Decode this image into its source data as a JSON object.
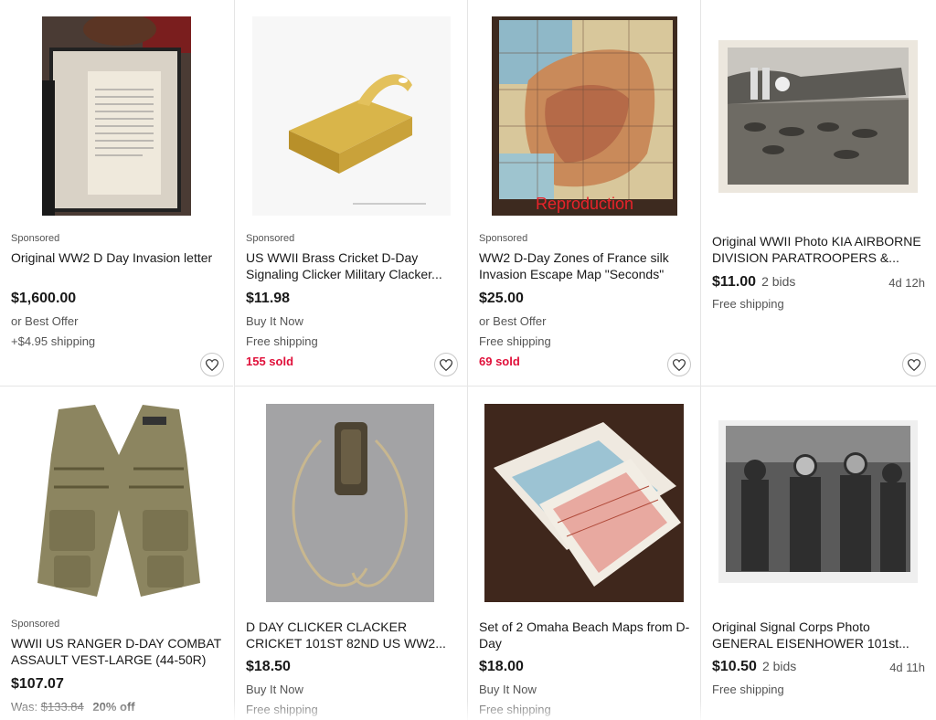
{
  "colors": {
    "sold_red": "#e0103a",
    "text": "#191919",
    "muted": "#555555"
  },
  "listings": [
    {
      "sponsored": "Sponsored",
      "title": "Original WW2 D Day Invasion letter",
      "price": "$1,600.00",
      "line1": "or Best Offer",
      "line2": "+$4.95 shipping",
      "image": "framed-letter-image",
      "watch_icon": "heart-icon"
    },
    {
      "sponsored": "Sponsored",
      "title": "US WWII Brass Cricket D-Day Signaling Clicker Military Clacker...",
      "price": "$11.98",
      "line1": "Buy It Now",
      "line2": "Free shipping",
      "sold": "155 sold",
      "image": "brass-cricket-image",
      "watch_icon": "heart-icon"
    },
    {
      "sponsored": "Sponsored",
      "title": "WW2 D-Day Zones of France silk Invasion Escape Map \"Seconds\"",
      "price": "$25.00",
      "line1": "or Best Offer",
      "line2": "Free shipping",
      "sold": "69 sold",
      "image_overlay": "Reproduction",
      "image": "france-map-image",
      "watch_icon": "heart-icon"
    },
    {
      "title": "Original WWII Photo KIA AIRBORNE DIVISION PARATROOPERS &...",
      "price": "$11.00",
      "bids": "2 bids",
      "time_left": "4d 12h",
      "line1": "Free shipping",
      "image": "glider-photo-image",
      "watch_icon": "heart-icon"
    },
    {
      "sponsored": "Sponsored",
      "title": "WWII US RANGER D-DAY COMBAT ASSAULT VEST-LARGE (44-50R)",
      "price": "$107.07",
      "was_label": "Was:",
      "was_price": "$133.84",
      "discount": "20% off",
      "image": "combat-vest-image"
    },
    {
      "title": "D DAY CLICKER CLACKER CRICKET 101ST 82ND US WW2...",
      "price": "$18.50",
      "line1": "Buy It Now",
      "line2": "Free shipping",
      "image": "clicker-lanyard-image"
    },
    {
      "title": "Set of 2 Omaha Beach Maps from D-Day",
      "price": "$18.00",
      "line1": "Buy It Now",
      "line2": "Free shipping",
      "image": "omaha-maps-image"
    },
    {
      "title": "Original Signal Corps Photo GENERAL EISENHOWER 101st...",
      "price": "$10.50",
      "bids": "2 bids",
      "time_left": "4d 11h",
      "line1": "Free shipping",
      "image": "eisenhower-photo-image"
    }
  ]
}
